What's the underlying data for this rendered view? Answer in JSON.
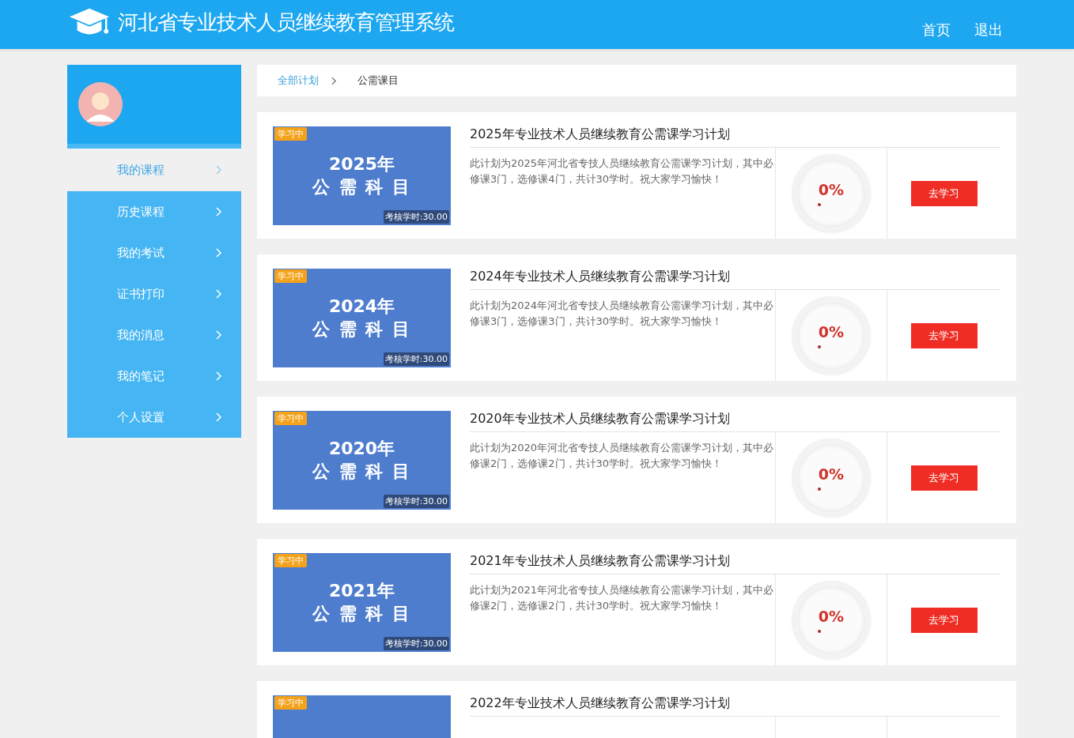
{
  "header": {
    "title": "河北省专业技术人员继续教育管理系统",
    "nav": [
      {
        "label": "首页"
      },
      {
        "label": "退出"
      }
    ]
  },
  "sidebar": {
    "items": [
      {
        "label": "我的课程",
        "selected": true
      },
      {
        "label": "历史课程",
        "selected": false
      },
      {
        "label": "我的考试",
        "selected": false
      },
      {
        "label": "证书打印",
        "selected": false
      },
      {
        "label": "我的消息",
        "selected": false
      },
      {
        "label": "我的笔记",
        "selected": false
      },
      {
        "label": "个人设置",
        "selected": false
      }
    ]
  },
  "breadcrumb": [
    {
      "label": "全部计划",
      "kind": "link"
    },
    {
      "label": "公需课目",
      "kind": "current"
    }
  ],
  "plans": [
    {
      "badge": "学习中",
      "cover_year": "2025年",
      "cover_subject": "公 需 科 目",
      "hours": "考核学时:30.00",
      "title": "2025年专业技术人员继续教育公需课学习计划",
      "description": "此计划为2025年河北省专技人员继续教育公需课学习计划，其中必修课3门，选修课4门，共计30学时。祝大家学习愉快！",
      "progress": {
        "reading": "0%"
      },
      "button": "去学习"
    },
    {
      "badge": "学习中",
      "cover_year": "2024年",
      "cover_subject": "公 需 科 目",
      "hours": "考核学时:30.00",
      "title": "2024年专业技术人员继续教育公需课学习计划",
      "description": "此计划为2024年河北省专技人员继续教育公需课学习计划，其中必修课3门，选修课3门，共计30学时。祝大家学习愉快！",
      "progress": {
        "reading": "0%"
      },
      "button": "去学习"
    },
    {
      "badge": "学习中",
      "cover_year": "2020年",
      "cover_subject": "公 需 科 目",
      "hours": "考核学时:30.00",
      "title": "2020年专业技术人员继续教育公需课学习计划",
      "description": "此计划为2020年河北省专技人员继续教育公需课学习计划，其中必修课2门，选修课2门，共计30学时。祝大家学习愉快！",
      "progress": {
        "reading": "0%"
      },
      "button": "去学习"
    },
    {
      "badge": "学习中",
      "cover_year": "2021年",
      "cover_subject": "公 需 科 目",
      "hours": "考核学时:30.00",
      "title": "2021年专业技术人员继续教育公需课学习计划",
      "description": "此计划为2021年河北省专技人员继续教育公需课学习计划，其中必修课2门，选修课2门，共计30学时。祝大家学习愉快！",
      "progress": {
        "reading": "0%"
      },
      "button": "去学习"
    },
    {
      "badge": "学习中",
      "title": "2022年专业技术人员继续教育公需课学习计划"
    }
  ]
}
